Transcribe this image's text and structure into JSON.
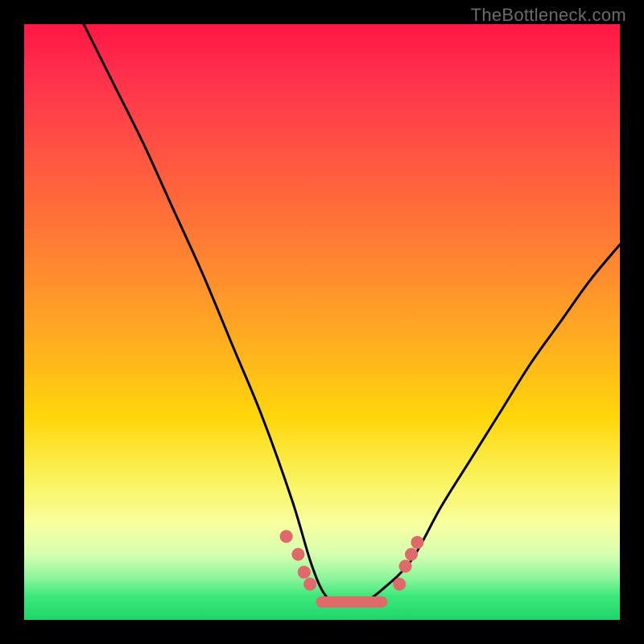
{
  "watermark": "TheBottleneck.com",
  "chart_data": {
    "type": "line",
    "title": "",
    "xlabel": "",
    "ylabel": "",
    "xlim": [
      0,
      100
    ],
    "ylim": [
      0,
      100
    ],
    "grid": false,
    "series": [
      {
        "name": "bottleneck-curve",
        "x": [
          10,
          15,
          20,
          25,
          30,
          35,
          40,
          45,
          48,
          50,
          52,
          55,
          57,
          60,
          65,
          70,
          75,
          80,
          85,
          90,
          95,
          100
        ],
        "y": [
          100,
          90,
          80,
          69,
          58,
          46,
          34,
          20,
          10,
          5,
          3,
          3,
          3,
          5,
          10,
          19,
          27,
          35,
          43,
          50,
          57,
          63
        ]
      }
    ],
    "markers": {
      "name": "highlight-dots",
      "color_hex": "#e06a6a",
      "points": [
        {
          "x": 44,
          "y": 14
        },
        {
          "x": 46,
          "y": 11
        },
        {
          "x": 47,
          "y": 8
        },
        {
          "x": 48,
          "y": 6
        },
        {
          "x": 63,
          "y": 6
        },
        {
          "x": 64,
          "y": 9
        },
        {
          "x": 65,
          "y": 11
        },
        {
          "x": 66,
          "y": 13
        }
      ]
    },
    "bottom_bar": {
      "name": "optimal-range-bar",
      "color_hex": "#e06a6a",
      "x_start": 49,
      "x_end": 61,
      "y": 3,
      "thickness_px": 14
    },
    "background_gradient": {
      "orientation": "vertical",
      "stops": [
        {
          "pos": 0.0,
          "hex": "#ff1744"
        },
        {
          "pos": 0.3,
          "hex": "#ff6a3a"
        },
        {
          "pos": 0.55,
          "hex": "#ffb01f"
        },
        {
          "pos": 0.76,
          "hex": "#faf25a"
        },
        {
          "pos": 0.9,
          "hex": "#b9f79f"
        },
        {
          "pos": 1.0,
          "hex": "#1fd66a"
        }
      ]
    }
  }
}
